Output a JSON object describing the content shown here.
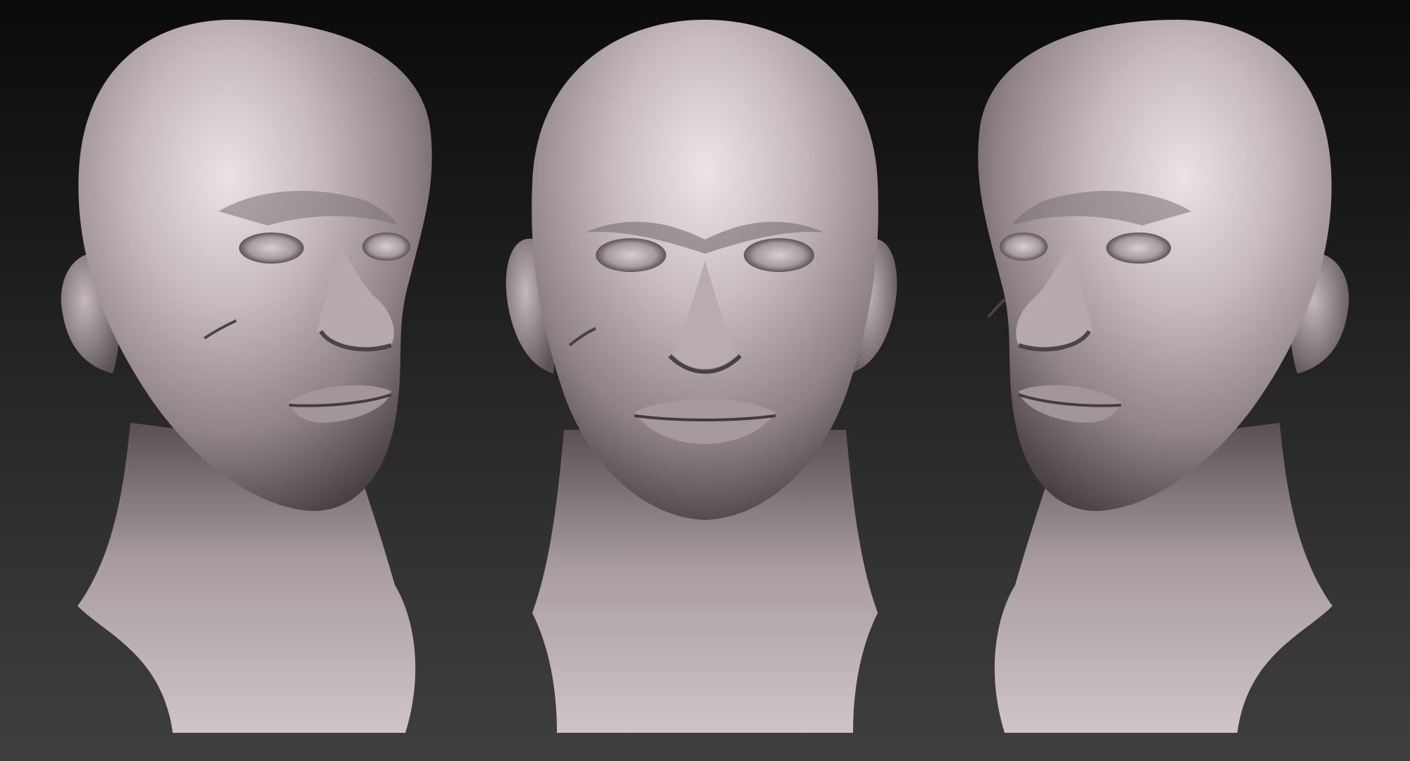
{
  "scene": {
    "background": {
      "top": "#0b0b0b",
      "bottom": "#3f3f3f"
    },
    "material": {
      "base": "#9b8f92",
      "highlight": "#ece2e6",
      "shadow": "#3b3336",
      "rim": "#b9aeb4"
    },
    "views": [
      {
        "id": "three-quarter-left",
        "label": ""
      },
      {
        "id": "front",
        "label": ""
      },
      {
        "id": "three-quarter-right",
        "label": ""
      }
    ]
  }
}
